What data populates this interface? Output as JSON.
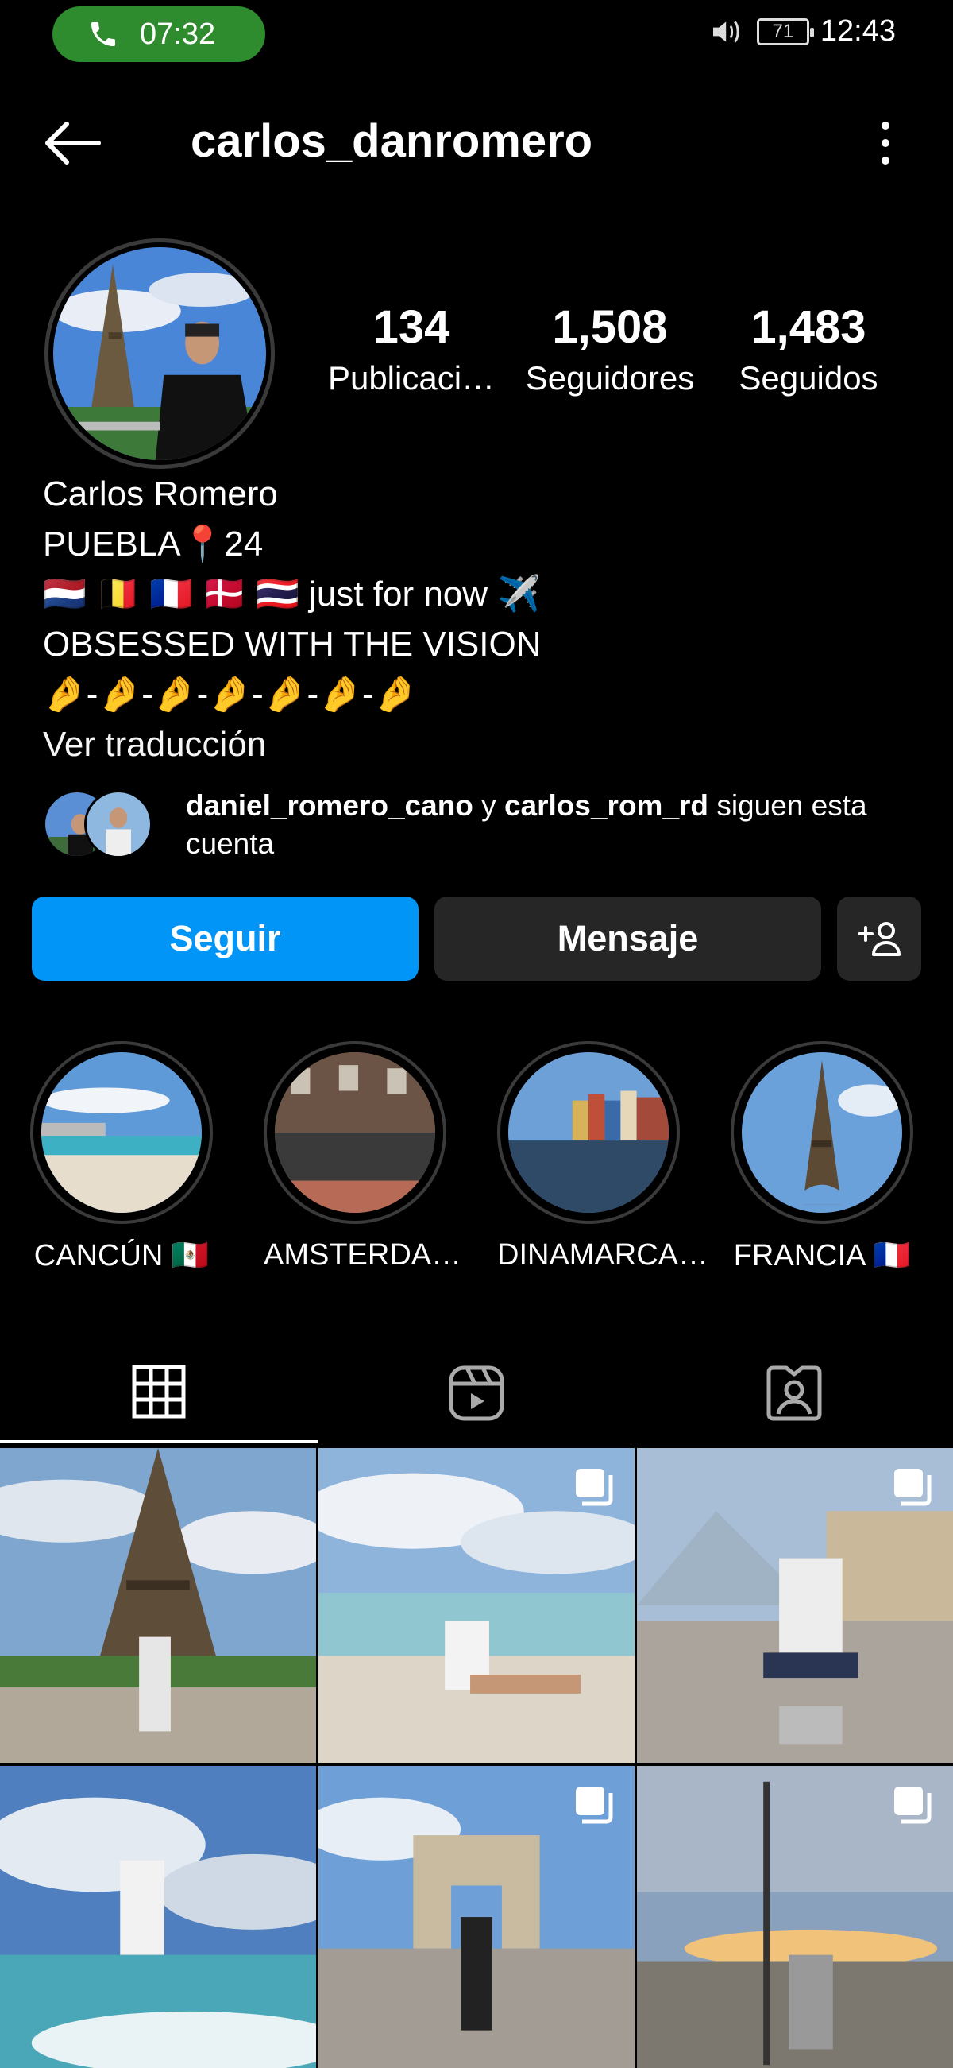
{
  "status_bar": {
    "call_time": "07:32",
    "battery": "71",
    "clock": "12:43"
  },
  "header": {
    "username": "carlos_danromero"
  },
  "stats": [
    {
      "value": "134",
      "label": "Publicaci…"
    },
    {
      "value": "1,508",
      "label": "Seguidores"
    },
    {
      "value": "1,483",
      "label": "Seguidos"
    }
  ],
  "bio": {
    "name": "Carlos Romero",
    "line1": "PUEBLA📍24",
    "line2": "🇳🇱 🇧🇪 🇫🇷 🇩🇰 🇹🇭 just for now ✈️",
    "line3": "OBSESSED WITH THE VISION",
    "line4": "🤌-🤌-🤌-🤌-🤌-🤌-🤌",
    "translate": "Ver traducción"
  },
  "followed_by": {
    "user1": "daniel_romero_cano",
    "conj": " y ",
    "user2": "carlos_rom_rd",
    "suffix": " siguen esta cuenta"
  },
  "actions": {
    "follow": "Seguir",
    "message": "Mensaje"
  },
  "highlights": [
    {
      "label": "CANCÚN 🇲🇽"
    },
    {
      "label": "AMSTERDA…"
    },
    {
      "label": "DINAMARCA…"
    },
    {
      "label": "FRANCIA 🇫🇷"
    }
  ],
  "icons": {
    "back": "arrow-left-icon",
    "more": "kebab-menu-icon",
    "add_person": "add-person-icon",
    "grid": "grid-icon",
    "reels": "reels-icon",
    "tagged": "tagged-icon",
    "multi": "carousel-icon"
  },
  "colors": {
    "accent": "#0095f6",
    "call_pill": "#2e8b2e",
    "secondary_button": "#262626"
  }
}
